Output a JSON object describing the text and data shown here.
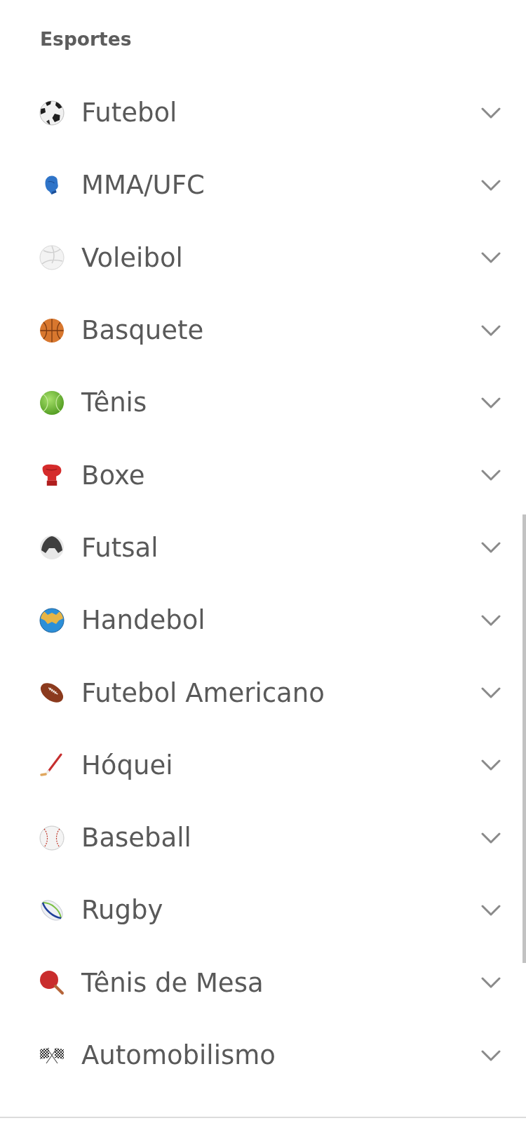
{
  "section": {
    "title": "Esportes"
  },
  "sports": [
    {
      "label": "Futebol",
      "expanded": false
    },
    {
      "label": "MMA/UFC",
      "expanded": false
    },
    {
      "label": "Voleibol",
      "expanded": false
    },
    {
      "label": "Basquete",
      "expanded": false
    },
    {
      "label": "Tênis",
      "expanded": false
    },
    {
      "label": "Boxe",
      "expanded": false
    },
    {
      "label": "Futsal",
      "expanded": false
    },
    {
      "label": "Handebol",
      "expanded": false
    },
    {
      "label": "Futebol Americano",
      "expanded": false
    },
    {
      "label": "Hóquei",
      "expanded": false
    },
    {
      "label": "Baseball",
      "expanded": false
    },
    {
      "label": "Rugby",
      "expanded": false
    },
    {
      "label": "Tênis de Mesa",
      "expanded": false
    },
    {
      "label": "Automobilismo",
      "expanded": false
    }
  ]
}
